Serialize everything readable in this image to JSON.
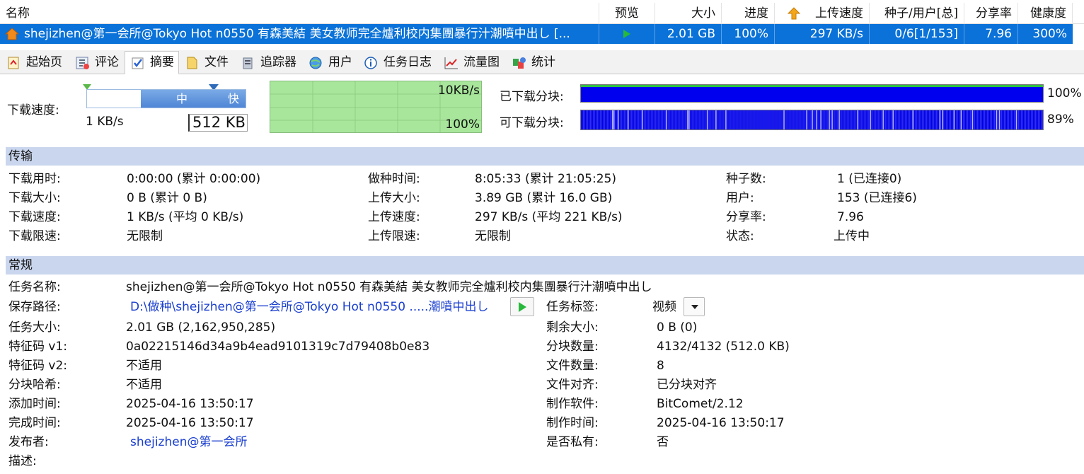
{
  "columns": {
    "name": "名称",
    "preview": "预览",
    "size": "大小",
    "progress": "进度",
    "up_speed": "上传速度",
    "seeds_peers": "种子/用户[总]",
    "ratio": "分享率",
    "health": "健康度"
  },
  "task": {
    "name": "shejizhen@第一会所@Tokyo Hot n0550 有森美結 美女教师完全爐利校内集團暴行汁潮噴中出し [...",
    "size": "2.01 GB",
    "progress": "100%",
    "up_speed": "297 KB/s",
    "seeds_peers": "0/6[1/153]",
    "ratio": "7.96",
    "health": "300%"
  },
  "tabs": [
    {
      "label": "起始页",
      "icon": "home-page-icon"
    },
    {
      "label": "评论",
      "icon": "comment-icon"
    },
    {
      "label": "摘要",
      "icon": "summary-check-icon"
    },
    {
      "label": "文件",
      "icon": "file-icon"
    },
    {
      "label": "追踪器",
      "icon": "tracker-icon"
    },
    {
      "label": "用户",
      "icon": "users-globe-icon"
    },
    {
      "label": "任务日志",
      "icon": "info-icon"
    },
    {
      "label": "流量图",
      "icon": "traffic-chart-icon"
    },
    {
      "label": "统计",
      "icon": "statistics-icon"
    }
  ],
  "speed": {
    "label": "下载速度:",
    "slider_mid": "中",
    "slider_fast": "快",
    "current": "1 KB/s",
    "limit_value": "512 KB",
    "graph_max": "10KB/s",
    "graph_pct": "100%",
    "downloaded_label": "已下载分块:",
    "downloaded_pct": "100%",
    "available_label": "可下载分块:",
    "available_pct": "89%",
    "downloaded_fraction": 1.0,
    "available_fraction": 0.89
  },
  "transfer": {
    "title": "传输",
    "rows": [
      [
        {
          "k": "下载用时:",
          "v": "0:00:00 (累计 0:00:00)"
        },
        {
          "k": "做种时间:",
          "v": "8:05:33 (累计 21:05:25)"
        },
        {
          "k": "种子数:",
          "v": "1 (已连接0)"
        }
      ],
      [
        {
          "k": "下载大小:",
          "v": "0 B (累计 0 B)"
        },
        {
          "k": "上传大小:",
          "v": "3.89 GB (累计 16.0 GB)"
        },
        {
          "k": "用户:",
          "v": "153 (已连接6)"
        }
      ],
      [
        {
          "k": "下载速度:",
          "v": "1 KB/s (平均 0 KB/s)"
        },
        {
          "k": "上传速度:",
          "v": "297 KB/s (平均 221 KB/s)"
        },
        {
          "k": "分享率:",
          "v": "7.96"
        }
      ],
      [
        {
          "k": "下载限速:",
          "v": "无限制"
        },
        {
          "k": "上传限速:",
          "v": "无限制"
        },
        {
          "k": "状态:",
          "v": "上传中"
        }
      ]
    ]
  },
  "general": {
    "title": "常规",
    "task_name_label": "任务名称:",
    "task_name": "shejizhen@第一会所@Tokyo Hot n0550 有森美結 美女教师完全爐利校内集團暴行汁潮噴中出し",
    "save_path_label": "保存路径:",
    "save_path": "D:\\做种\\shejizhen@第一会所@Tokyo Hot n0550 .....潮噴中出し",
    "tag_label": "任务标签:",
    "tag_value": "视频",
    "left": [
      {
        "k": "任务大小:",
        "v": "2.01 GB (2,162,950,285)"
      },
      {
        "k": "特征码 v1:",
        "v": "0a02215146d34a9b4ead9101319c7d79408b0e83"
      },
      {
        "k": "特征码 v2:",
        "v": "不适用"
      },
      {
        "k": "分块哈希:",
        "v": "不适用"
      },
      {
        "k": "添加时间:",
        "v": "2025-04-16 13:50:17"
      },
      {
        "k": "完成时间:",
        "v": "2025-04-16 13:50:17"
      }
    ],
    "right": [
      {
        "k": "剩余大小:",
        "v": "0 B (0)"
      },
      {
        "k": "分块数量:",
        "v": "4132/4132 (512.0 KB)"
      },
      {
        "k": "文件数量:",
        "v": "8"
      },
      {
        "k": "文件对齐:",
        "v": "已分块对齐"
      },
      {
        "k": "制作软件:",
        "v": "BitComet/2.12"
      },
      {
        "k": "制作时间:",
        "v": "2025-04-16 13:50:17"
      }
    ],
    "publisher_label": "发布者:",
    "publisher": "shejizhen@第一会所",
    "private_label": "是否私有:",
    "private_value": "否",
    "desc_label": "描述:"
  },
  "colors": {
    "selected_row": "#0a72d8",
    "section_head": "#c9d6ee",
    "graph_bg": "#a8e69c",
    "piece_blue": "#0000ee",
    "link": "#1a3fcf"
  }
}
